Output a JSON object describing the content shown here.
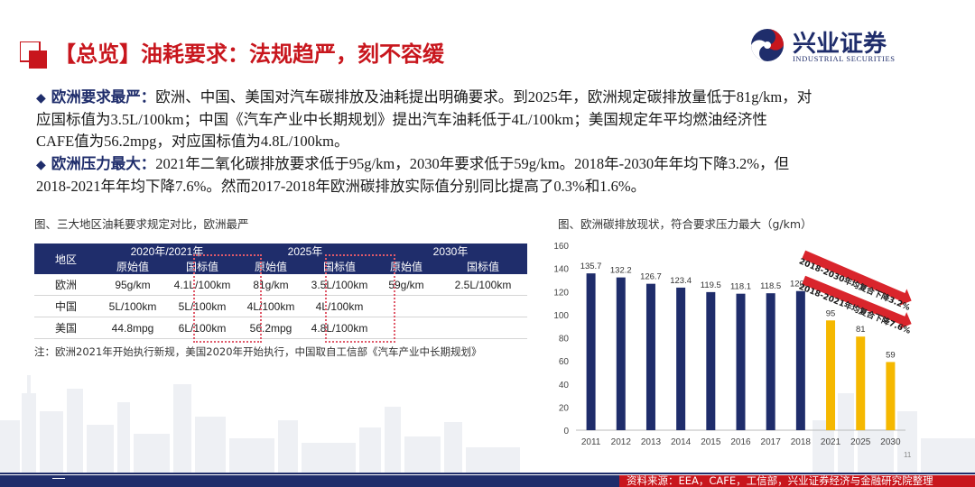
{
  "header": {
    "title": "【总览】油耗要求：法规趋严，刻不容缓",
    "brand_cn": "兴业证券",
    "brand_en": "INDUSTRIAL SECURITIES"
  },
  "bullets": [
    {
      "head": "欧洲要求最严：",
      "line1": "欧洲、中国、美国对汽车碳排放及油耗提出明确要求。到2025年，欧洲规定碳排放量低于81g/km，对",
      "line2": "应国标值为3.5L/100km；中国《汽车产业中长期规划》提出汽车油耗低于4L/100km；美国规定年平均燃油经济性",
      "line3": "CAFE值为56.2mpg，对应国标值为4.8L/100km。"
    },
    {
      "head": "欧洲压力最大：",
      "line1": "2021年二氧化碳排放要求低于95g/km，2030年要求低于59g/km。2018年-2030年年均下降3.2%，但",
      "line2": "2018-2021年年均下降7.6%。然而2017-2018年欧洲碳排放实际值分别同比提高了0.3%和1.6%。"
    }
  ],
  "table_caption": "图、三大地区油耗要求规定对比，欧洲最严",
  "table": {
    "region_header": "地区",
    "year_headers": [
      "2020年/2021年",
      "2025年",
      "2030年"
    ],
    "sub_headers": [
      "原始值",
      "国标值",
      "原始值",
      "国标值",
      "原始值",
      "国标值"
    ],
    "rows": [
      {
        "region": "欧洲",
        "cells": [
          "95g/km",
          "4.1L/100km",
          "81g/km",
          "3.5L/100km",
          "59g/km",
          "2.5L/100km"
        ]
      },
      {
        "region": "中国",
        "cells": [
          "5L/100km",
          "5L/100km",
          "4L/100km",
          "4L/100km",
          "",
          ""
        ]
      },
      {
        "region": "美国",
        "cells": [
          "44.8mpg",
          "6L/100km",
          "56.2mpg",
          "4.8L/100km",
          "",
          ""
        ]
      }
    ],
    "note": "注：欧洲2021年开始执行新规，美国2020年开始执行，中国取自工信部《汽车产业中长期规划》"
  },
  "chart_caption": "图、欧洲碳排放现状，符合要求压力最大（g/km）",
  "chart_data": {
    "type": "bar",
    "categories": [
      "2011",
      "2012",
      "2013",
      "2014",
      "2015",
      "2016",
      "2017",
      "2018",
      "2021",
      "2025",
      "2030"
    ],
    "values": [
      135.7,
      132.2,
      126.7,
      123.4,
      119.5,
      118.1,
      118.5,
      120.4,
      95,
      81,
      59
    ],
    "value_labels": [
      "135.7",
      "132.2",
      "126.7",
      "123.4",
      "119.5",
      "118.1",
      "118.5",
      "120.4",
      "95",
      "81",
      "59"
    ],
    "ylim": [
      0,
      160
    ],
    "yticks": [
      0,
      20,
      40,
      60,
      80,
      100,
      120,
      140,
      160
    ],
    "colors": {
      "actual": "#1f2d6b",
      "target": "#f5b800",
      "arrow": "#d9252c"
    },
    "annotations": [
      "2018-2030年均复合下降3.2%",
      "2018-2021年均复合下降7.6%"
    ],
    "grid": false
  },
  "page_number": "11",
  "footer": {
    "source": "资料来源：EEA，CAFE，工信部，兴业证券经济与金融研究院整理"
  }
}
